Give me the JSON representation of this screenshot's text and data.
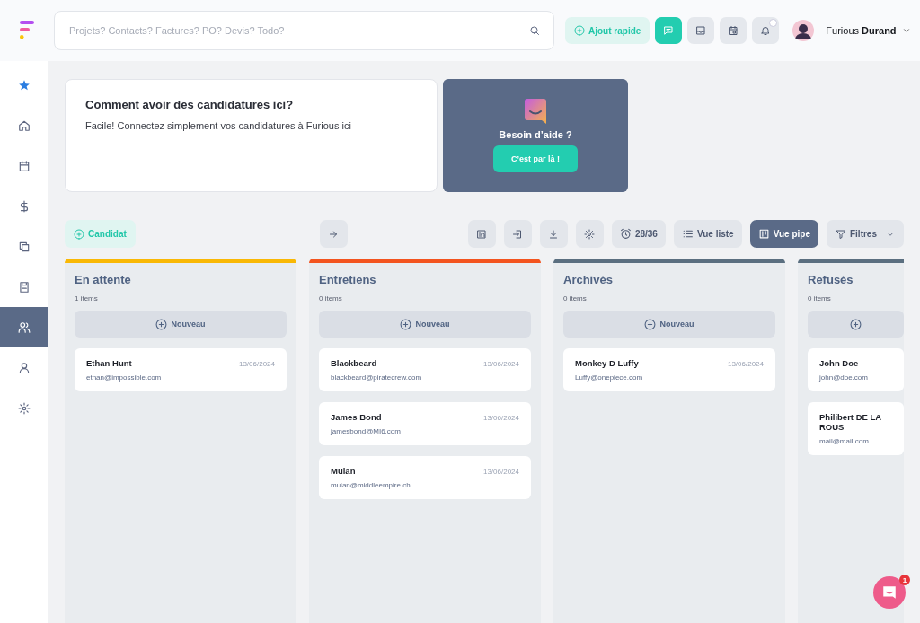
{
  "header": {
    "search": {
      "placeholder": "Projets? Contacts? Factures? PO? Devis? Todo?"
    },
    "quick_add": {
      "label": "Ajout rapide"
    },
    "icon_buttons": [
      {
        "selected": true
      },
      {
        "selected": false
      },
      {
        "selected": false
      },
      {
        "selected": false,
        "badge": true
      }
    ],
    "user": {
      "name": "Furious **Durand**"
    }
  },
  "sidebar": {
    "items": [
      {
        "selected": false
      },
      {
        "selected": false
      },
      {
        "selected": false
      },
      {
        "selected": false
      },
      {
        "selected": false
      },
      {
        "selected": false
      },
      {
        "selected": true
      },
      {
        "selected": false
      },
      {
        "selected": false
      }
    ]
  },
  "info_card": {
    "title": "Comment avoir des candidatures ici?",
    "text": "Facile! Connectez simplement vos candidatures à Furious ici"
  },
  "help_card": {
    "title": "Besoin d’aide ?",
    "button": "C’est par là !"
  },
  "toolbar": {
    "add_button": "Candidat",
    "tools": [
      {
        "kind": "icon"
      },
      {
        "kind": "icon"
      },
      {
        "kind": "icon"
      },
      {
        "kind": "icon"
      },
      {
        "kind": "counter",
        "label": "28/36"
      },
      {
        "kind": "view",
        "label": "Vue liste",
        "selected": false
      },
      {
        "kind": "view",
        "label": "Vue pipe",
        "selected": true
      },
      {
        "kind": "dropdown",
        "label": "Filtres"
      }
    ]
  },
  "columns": [
    {
      "title": "En attente",
      "count": "1 items",
      "color": "#f9b805",
      "new_label": "Nouveau",
      "cards": [
        {
          "name": "Ethan Hunt",
          "email": "ethan@impossible.com",
          "date": "13/06/2024"
        }
      ]
    },
    {
      "title": "Entretiens",
      "count": "0 items",
      "color": "#f3541f",
      "new_label": "Nouveau",
      "cards": [
        {
          "name": "Blackbeard",
          "email": "blackbeard@piratecrew.com",
          "date": "13/06/2024"
        },
        {
          "name": "James Bond",
          "email": "jamesbond@MI6.com",
          "date": "13/06/2024"
        },
        {
          "name": "Mulan",
          "email": "mulan@middleempire.ch",
          "date": "13/06/2024"
        }
      ]
    },
    {
      "title": "Archivés",
      "count": "0 items",
      "color": "#5b6f80",
      "new_label": "Nouveau",
      "cards": [
        {
          "name": "Monkey D Luffy",
          "email": "Luffy@onepiece.com",
          "date": "13/06/2024"
        }
      ]
    },
    {
      "title": "Refusés",
      "count": "0 items",
      "color": "#5b6f80",
      "cards": [
        {
          "name": "John Doe",
          "email": "john@doe.com"
        },
        {
          "name": "Philibert DE LA ROUS",
          "email": "mail@mail.com"
        }
      ]
    }
  ],
  "chat_launcher": {
    "badge": "1"
  }
}
